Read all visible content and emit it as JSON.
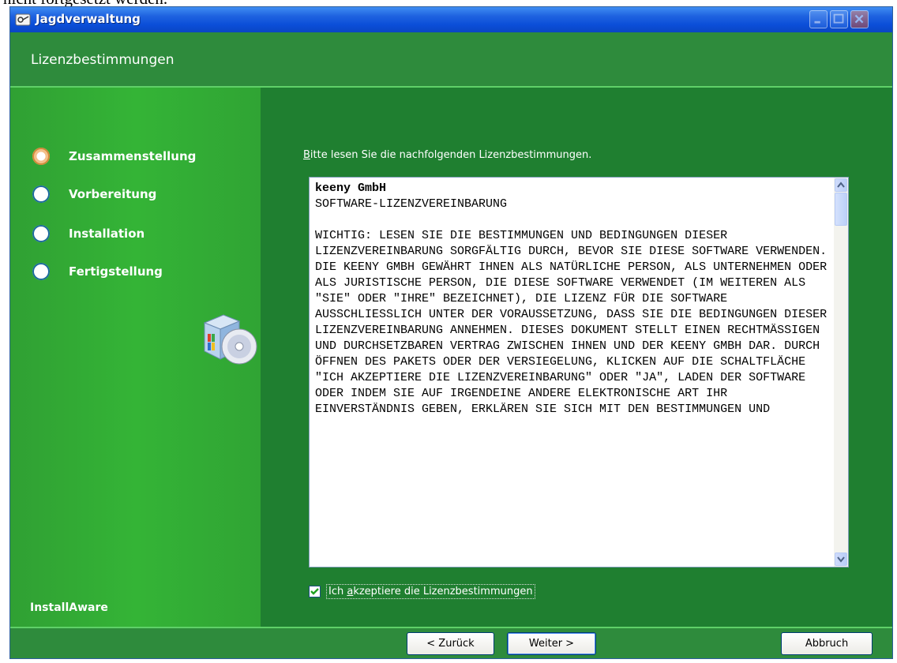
{
  "document_fragment": "nicht fortgesetzt werden.",
  "window": {
    "title": "Jagdverwaltung"
  },
  "header": {
    "title": "Lizenzbestimmungen"
  },
  "steps": [
    {
      "label": "Zusammenstellung",
      "state": "current"
    },
    {
      "label": "Vorbereitung",
      "state": "pending"
    },
    {
      "label": "Installation",
      "state": "pending"
    },
    {
      "label": "Fertigstellung",
      "state": "pending"
    }
  ],
  "brand": "InstallAware",
  "license": {
    "prompt_prefix": "B",
    "prompt_rest": "itte lesen Sie die nachfolgenden Lizenzbestimmungen.",
    "company": "keeny GmbH",
    "text": "\nSOFTWARE-LIZENZVEREINBARUNG\n\nWICHTIG: LESEN SIE DIE BESTIMMUNGEN UND BEDINGUNGEN DIESER LIZENZVEREINBARUNG SORGFÄLTIG DURCH, BEVOR SIE DIESE SOFTWARE VERWENDEN. DIE KEENY GMBH GEWÄHRT IHNEN ALS NATÜRLICHE PERSON, ALS UNTERNEHMEN ODER ALS JURISTISCHE PERSON, DIE DIESE SOFTWARE VERWENDET (IM WEITEREN ALS \"SIE\" ODER \"IHRE\" BEZEICHNET), DIE LIZENZ FÜR DIE SOFTWARE AUSSCHLIESSLICH UNTER DER VORAUSSETZUNG, DASS SIE DIE BEDINGUNGEN DIESER LIZENZVEREINBARUNG ANNEHMEN. DIESES DOKUMENT STELLT EINEN RECHTMÄSSIGEN UND DURCHSETZBAREN VERTRAG ZWISCHEN IHNEN UND DER KEENY GMBH DAR. DURCH ÖFFNEN DES PAKETS ODER DER VERSIEGELUNG, KLICKEN AUF DIE SCHALTFLÄCHE \"ICH AKZEPTIERE DIE LIZENZVEREINBARUNG\" ODER \"JA\", LADEN DER SOFTWARE ODER INDEM SIE AUF IRGENDEINE ANDERE ELEKTRONISCHE ART IHR EINVERSTÄNDNIS GEBEN, ERKLÄREN SIE SICH MIT DEN BESTIMMUNGEN UND",
    "accept_pre": "Ich ",
    "accept_key": "a",
    "accept_post": "kzeptiere die Lizenzbestimmungen",
    "accepted": true
  },
  "buttons": {
    "back": "< Zurück",
    "next": "Weiter >",
    "cancel": "Abbruch"
  },
  "colors": {
    "titlebar": "#0b4ed8",
    "background": "#2e8b3c",
    "left_panel": "#34b436",
    "accent_line": "#5fd068"
  }
}
